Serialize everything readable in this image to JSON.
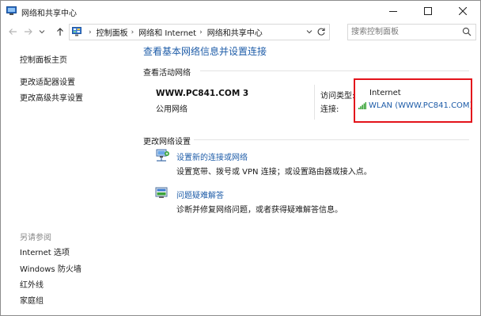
{
  "window": {
    "title": "网络和共享中心"
  },
  "nav": {
    "breadcrumbs": [
      "控制面板",
      "网络和 Internet",
      "网络和共享中心"
    ],
    "search_placeholder": "搜索控制面板"
  },
  "sidebar": {
    "links": [
      "控制面板主页",
      "更改适配器设置",
      "更改高级共享设置"
    ],
    "see_also_heading": "另请参阅",
    "see_also": [
      "Internet 选项",
      "Windows 防火墙",
      "红外线",
      "家庭组"
    ]
  },
  "main": {
    "title": "查看基本网络信息并设置连接",
    "active_networks_label": "查看活动网络",
    "network": {
      "name": "WWW.PC841.COM  3",
      "type": "公用网络",
      "access_type_label": "访问类型:",
      "access_type_value": "Internet",
      "connection_label": "连接:",
      "connection_value": "WLAN (WWW.PC841.COM)"
    },
    "change_settings_label": "更改网络设置",
    "tasks": [
      {
        "link": "设置新的连接或网络",
        "desc": "设置宽带、拨号或 VPN 连接；或设置路由器或接入点。",
        "icon": "network-setup-icon"
      },
      {
        "link": "问题疑难解答",
        "desc": "诊断并修复网络问题，或者获得疑难解答信息。",
        "icon": "troubleshoot-icon"
      }
    ]
  },
  "colors": {
    "link": "#1e5ca8",
    "highlight": "#e3131b",
    "signal": "#3aa43a"
  }
}
